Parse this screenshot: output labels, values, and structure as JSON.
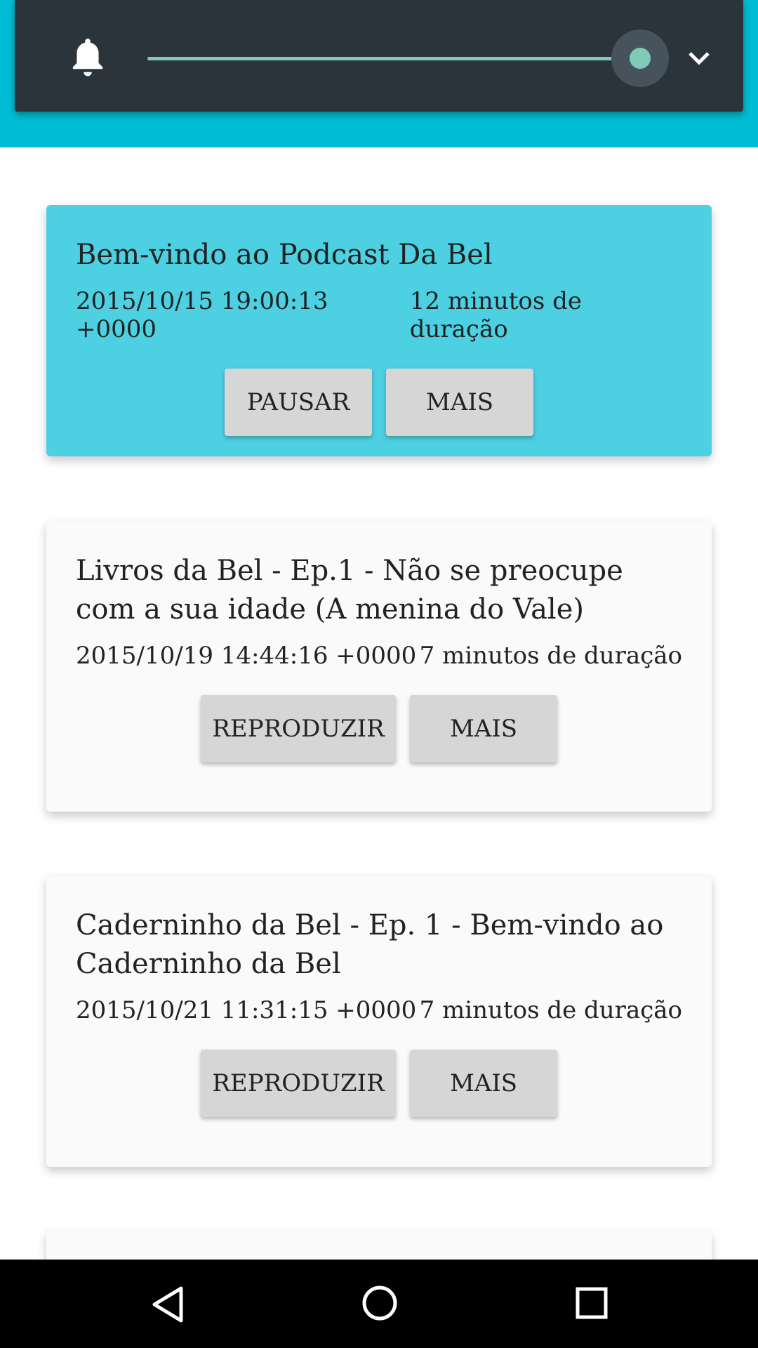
{
  "notification_panel": {
    "icon": "bell-icon",
    "volume_level": 0.92,
    "expand_icon": "chevron-down-icon"
  },
  "episodes": [
    {
      "title": "Bem-vindo ao Podcast Da Bel",
      "date": "2015/10/15 19:00:13 +0000",
      "duration": "12 minutos de duração",
      "primary_label": "PAUSAR",
      "more_label": "MAIS",
      "state": "playing"
    },
    {
      "title": "Livros da Bel - Ep.1 - Não se preocupe com a sua idade (A menina do Vale)",
      "date": "2015/10/19 14:44:16 +0000",
      "duration": "7 minutos de duração",
      "primary_label": "REPRODUZIR",
      "more_label": "MAIS",
      "state": "idle"
    },
    {
      "title": "Caderninho da Bel - Ep. 1 - Bem-vindo ao Caderninho da Bel",
      "date": "2015/10/21 11:31:15 +0000",
      "duration": "7 minutos de duração",
      "primary_label": "REPRODUZIR",
      "more_label": "MAIS",
      "state": "idle"
    }
  ],
  "colors": {
    "app_bar": "#00bcd4",
    "active_card": "#4dd0e1",
    "panel": "#2b333b",
    "slider": "#7fcbb8"
  },
  "nav": {
    "back_icon": "back-triangle-icon",
    "home_icon": "home-circle-icon",
    "recents_icon": "recents-square-icon"
  }
}
